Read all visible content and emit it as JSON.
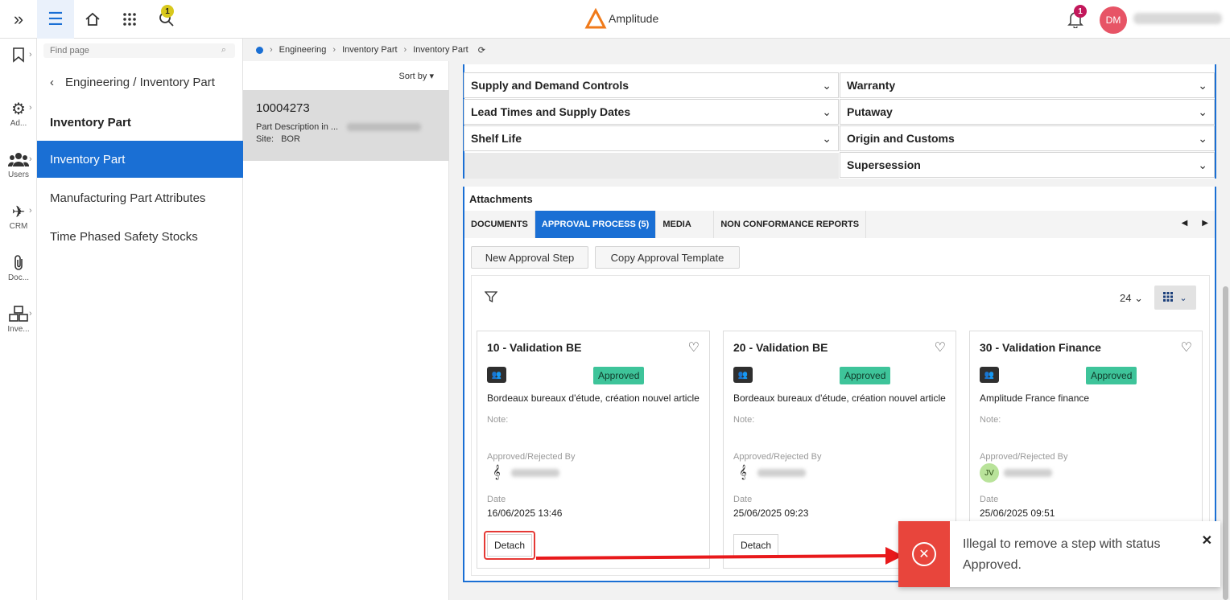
{
  "app": {
    "logo_text": "Amplitude",
    "search_badge": "1",
    "notif_badge": "1",
    "avatar_initials": "DM"
  },
  "rail": [
    {
      "label": "",
      "icon": "bookmark-icon"
    },
    {
      "label": "Ad...",
      "icon": "gear-icon"
    },
    {
      "label": "Users",
      "icon": "users-icon"
    },
    {
      "label": "CRM",
      "icon": "plane-icon"
    },
    {
      "label": "Doc...",
      "icon": "paperclip-icon"
    },
    {
      "label": "Inve...",
      "icon": "boxes-icon"
    }
  ],
  "nav": {
    "find_placeholder": "Find page",
    "back_label": "Engineering / Inventory Part",
    "section_title": "Inventory Part",
    "items": [
      "Inventory Part",
      "Manufacturing Part Attributes",
      "Time Phased Safety Stocks"
    ]
  },
  "breadcrumb": [
    "Engineering",
    "Inventory Part",
    "Inventory Part"
  ],
  "list": {
    "sort_label": "Sort by",
    "record": {
      "id": "10004273",
      "desc_label": "Part Description in ...",
      "site_label": "Site:",
      "site_value": "BOR"
    }
  },
  "accordions": {
    "left": [
      "Supply and Demand Controls",
      "Lead Times and Supply Dates",
      "Shelf Life"
    ],
    "right": [
      "Warranty",
      "Putaway",
      "Origin and Customs",
      "Supersession"
    ]
  },
  "attachments": {
    "title": "Attachments",
    "tabs": [
      "DOCUMENTS",
      "APPROVAL PROCESS (5)",
      "MEDIA",
      "NON CONFORMANCE REPORTS"
    ],
    "buttons": {
      "new_step": "New Approval Step",
      "copy_template": "Copy Approval Template"
    },
    "page_size": "24",
    "cards": [
      {
        "title": "10 - Validation BE",
        "status": "Approved",
        "desc": "Bordeaux bureaux d'étude, création nouvel article",
        "note_label": "Note:",
        "by_label": "Approved/Rejected By",
        "date_label": "Date",
        "date": "16/06/2025 13:46",
        "detach": "Detach"
      },
      {
        "title": "20 - Validation BE",
        "status": "Approved",
        "desc": "Bordeaux bureaux d'étude, création nouvel article",
        "note_label": "Note:",
        "by_label": "Approved/Rejected By",
        "date_label": "Date",
        "date": "25/06/2025 09:23",
        "detach": "Detach"
      },
      {
        "title": "30 - Validation Finance",
        "status": "Approved",
        "desc": "Amplitude France finance",
        "note_label": "Note:",
        "by_label": "Approved/Rejected By",
        "signer_initials": "JV",
        "date_label": "Date",
        "date": "25/06/2025 09:51"
      }
    ]
  },
  "toast": {
    "message": "Illegal to remove a step with status Approved."
  },
  "colors": {
    "accent": "#1a6fd4",
    "approved": "#3ec49a",
    "error": "#e8453c",
    "avatar": "#e75466"
  }
}
